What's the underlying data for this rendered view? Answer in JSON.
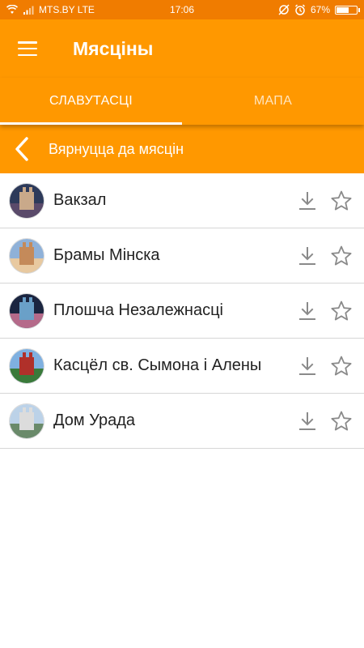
{
  "status_bar": {
    "carrier": "MTS.BY LTE",
    "time": "17:06",
    "battery": "67%",
    "battery_level": 0.67
  },
  "app_bar": {
    "title": "Мясціны",
    "menu_icon": "menu-icon"
  },
  "tabs": [
    {
      "label": "СЛАВУТАСЦІ",
      "active": true
    },
    {
      "label": "МАПА",
      "active": false
    }
  ],
  "back_bar": {
    "label": "Вярнуцца да мясцін",
    "icon": "chevron-left-icon"
  },
  "places": [
    {
      "name": "Вакзал",
      "image": "vakzal-thumb",
      "colors": [
        "#2d3a5a",
        "#c9a98a",
        "#5a4a6a"
      ]
    },
    {
      "name": "Брамы Мінска",
      "image": "bramy-thumb",
      "colors": [
        "#8fb1d8",
        "#c48a5a",
        "#e8c9a0"
      ]
    },
    {
      "name": "Плошча Незалежнасці",
      "image": "ploshcha-thumb",
      "colors": [
        "#1b2540",
        "#6aa0c8",
        "#b56a8a"
      ]
    },
    {
      "name": "Касцёл св. Сымона і Алены",
      "image": "kascel-thumb",
      "colors": [
        "#7fb0e0",
        "#b0302a",
        "#3a7a3a"
      ]
    },
    {
      "name": "Дом Урада",
      "image": "dom-urada-thumb",
      "colors": [
        "#bcd2e8",
        "#dcdcdc",
        "#6a8a6a"
      ]
    }
  ],
  "colors": {
    "status_bar": "#f07c00",
    "primary": "#ff9800",
    "icon_gray": "#8a8a8a"
  }
}
